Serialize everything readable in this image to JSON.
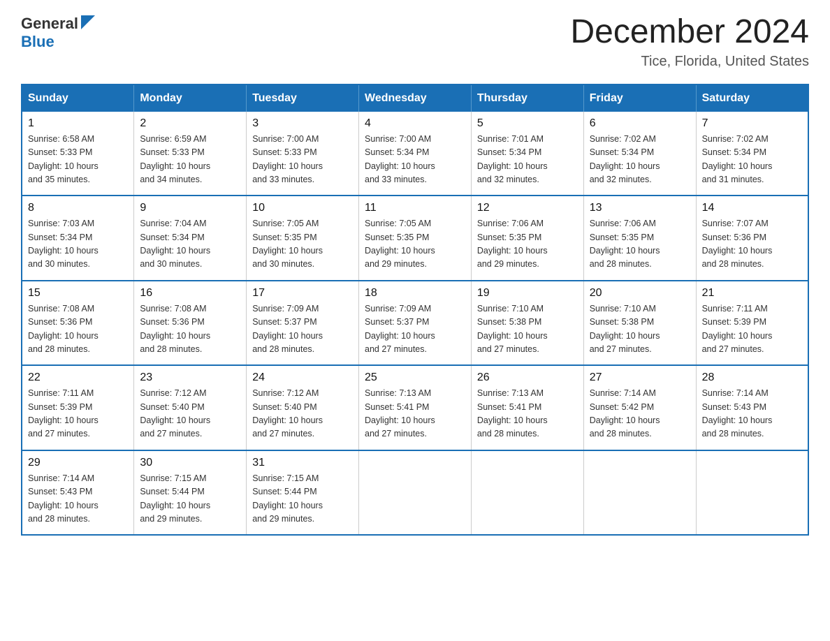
{
  "header": {
    "logo_general": "General",
    "logo_blue": "Blue",
    "title": "December 2024",
    "subtitle": "Tice, Florida, United States"
  },
  "days_of_week": [
    "Sunday",
    "Monday",
    "Tuesday",
    "Wednesday",
    "Thursday",
    "Friday",
    "Saturday"
  ],
  "weeks": [
    [
      {
        "day": "1",
        "sunrise": "6:58 AM",
        "sunset": "5:33 PM",
        "daylight": "10 hours and 35 minutes."
      },
      {
        "day": "2",
        "sunrise": "6:59 AM",
        "sunset": "5:33 PM",
        "daylight": "10 hours and 34 minutes."
      },
      {
        "day": "3",
        "sunrise": "7:00 AM",
        "sunset": "5:33 PM",
        "daylight": "10 hours and 33 minutes."
      },
      {
        "day": "4",
        "sunrise": "7:00 AM",
        "sunset": "5:34 PM",
        "daylight": "10 hours and 33 minutes."
      },
      {
        "day": "5",
        "sunrise": "7:01 AM",
        "sunset": "5:34 PM",
        "daylight": "10 hours and 32 minutes."
      },
      {
        "day": "6",
        "sunrise": "7:02 AM",
        "sunset": "5:34 PM",
        "daylight": "10 hours and 32 minutes."
      },
      {
        "day": "7",
        "sunrise": "7:02 AM",
        "sunset": "5:34 PM",
        "daylight": "10 hours and 31 minutes."
      }
    ],
    [
      {
        "day": "8",
        "sunrise": "7:03 AM",
        "sunset": "5:34 PM",
        "daylight": "10 hours and 30 minutes."
      },
      {
        "day": "9",
        "sunrise": "7:04 AM",
        "sunset": "5:34 PM",
        "daylight": "10 hours and 30 minutes."
      },
      {
        "day": "10",
        "sunrise": "7:05 AM",
        "sunset": "5:35 PM",
        "daylight": "10 hours and 30 minutes."
      },
      {
        "day": "11",
        "sunrise": "7:05 AM",
        "sunset": "5:35 PM",
        "daylight": "10 hours and 29 minutes."
      },
      {
        "day": "12",
        "sunrise": "7:06 AM",
        "sunset": "5:35 PM",
        "daylight": "10 hours and 29 minutes."
      },
      {
        "day": "13",
        "sunrise": "7:06 AM",
        "sunset": "5:35 PM",
        "daylight": "10 hours and 28 minutes."
      },
      {
        "day": "14",
        "sunrise": "7:07 AM",
        "sunset": "5:36 PM",
        "daylight": "10 hours and 28 minutes."
      }
    ],
    [
      {
        "day": "15",
        "sunrise": "7:08 AM",
        "sunset": "5:36 PM",
        "daylight": "10 hours and 28 minutes."
      },
      {
        "day": "16",
        "sunrise": "7:08 AM",
        "sunset": "5:36 PM",
        "daylight": "10 hours and 28 minutes."
      },
      {
        "day": "17",
        "sunrise": "7:09 AM",
        "sunset": "5:37 PM",
        "daylight": "10 hours and 28 minutes."
      },
      {
        "day": "18",
        "sunrise": "7:09 AM",
        "sunset": "5:37 PM",
        "daylight": "10 hours and 27 minutes."
      },
      {
        "day": "19",
        "sunrise": "7:10 AM",
        "sunset": "5:38 PM",
        "daylight": "10 hours and 27 minutes."
      },
      {
        "day": "20",
        "sunrise": "7:10 AM",
        "sunset": "5:38 PM",
        "daylight": "10 hours and 27 minutes."
      },
      {
        "day": "21",
        "sunrise": "7:11 AM",
        "sunset": "5:39 PM",
        "daylight": "10 hours and 27 minutes."
      }
    ],
    [
      {
        "day": "22",
        "sunrise": "7:11 AM",
        "sunset": "5:39 PM",
        "daylight": "10 hours and 27 minutes."
      },
      {
        "day": "23",
        "sunrise": "7:12 AM",
        "sunset": "5:40 PM",
        "daylight": "10 hours and 27 minutes."
      },
      {
        "day": "24",
        "sunrise": "7:12 AM",
        "sunset": "5:40 PM",
        "daylight": "10 hours and 27 minutes."
      },
      {
        "day": "25",
        "sunrise": "7:13 AM",
        "sunset": "5:41 PM",
        "daylight": "10 hours and 27 minutes."
      },
      {
        "day": "26",
        "sunrise": "7:13 AM",
        "sunset": "5:41 PM",
        "daylight": "10 hours and 28 minutes."
      },
      {
        "day": "27",
        "sunrise": "7:14 AM",
        "sunset": "5:42 PM",
        "daylight": "10 hours and 28 minutes."
      },
      {
        "day": "28",
        "sunrise": "7:14 AM",
        "sunset": "5:43 PM",
        "daylight": "10 hours and 28 minutes."
      }
    ],
    [
      {
        "day": "29",
        "sunrise": "7:14 AM",
        "sunset": "5:43 PM",
        "daylight": "10 hours and 28 minutes."
      },
      {
        "day": "30",
        "sunrise": "7:15 AM",
        "sunset": "5:44 PM",
        "daylight": "10 hours and 29 minutes."
      },
      {
        "day": "31",
        "sunrise": "7:15 AM",
        "sunset": "5:44 PM",
        "daylight": "10 hours and 29 minutes."
      },
      null,
      null,
      null,
      null
    ]
  ],
  "labels": {
    "sunrise": "Sunrise:",
    "sunset": "Sunset:",
    "daylight": "Daylight:"
  }
}
